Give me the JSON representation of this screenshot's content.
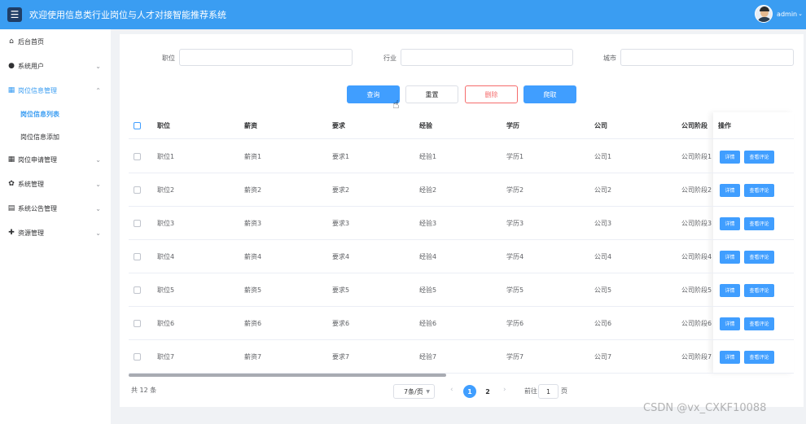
{
  "header": {
    "menu_icon": "☰",
    "title": "欢迎使用信息类行业岗位与人才对接智能推荐系统",
    "user_name": "admin",
    "user_caret": "⌄"
  },
  "sidebar": {
    "items": [
      {
        "label": "后台首页",
        "icon": "⌂"
      },
      {
        "label": "系统用户",
        "icon": "●",
        "chevron": "⌄"
      },
      {
        "label": "岗位信息管理",
        "icon": "▦",
        "chevron": "⌃"
      },
      {
        "label": "岗位申请管理",
        "icon": "▦",
        "chevron": "⌄"
      },
      {
        "label": "系统管理",
        "icon": "✿",
        "chevron": "⌄"
      },
      {
        "label": "系统公告管理",
        "icon": "▤",
        "chevron": "⌄"
      },
      {
        "label": "资源管理",
        "icon": "✚",
        "chevron": "⌄"
      }
    ],
    "sub_items": [
      {
        "label": "岗位信息列表"
      },
      {
        "label": "岗位信息添加"
      }
    ]
  },
  "filters": {
    "position_label": "职位",
    "position_value": "",
    "industry_label": "行业",
    "industry_value": "",
    "city_label": "城市",
    "city_value": ""
  },
  "actions": {
    "search": "查询",
    "reset": "重置",
    "delete": "删除",
    "crawl": "爬取"
  },
  "table": {
    "columns": [
      "职位",
      "薪资",
      "要求",
      "经验",
      "学历",
      "公司",
      "公司阶段",
      "操作"
    ],
    "rows": [
      [
        "职位1",
        "薪资1",
        "要求1",
        "经验1",
        "学历1",
        "公司1",
        "公司阶段1"
      ],
      [
        "职位2",
        "薪资2",
        "要求2",
        "经验2",
        "学历2",
        "公司2",
        "公司阶段2"
      ],
      [
        "职位3",
        "薪资3",
        "要求3",
        "经验3",
        "学历3",
        "公司3",
        "公司阶段3"
      ],
      [
        "职位4",
        "薪资4",
        "要求4",
        "经验4",
        "学历4",
        "公司4",
        "公司阶段4"
      ],
      [
        "职位5",
        "薪资5",
        "要求5",
        "经验5",
        "学历5",
        "公司5",
        "公司阶段5"
      ],
      [
        "职位6",
        "薪资6",
        "要求6",
        "经验6",
        "学历6",
        "公司6",
        "公司阶段6"
      ],
      [
        "职位7",
        "薪资7",
        "要求7",
        "经验7",
        "学历7",
        "公司7",
        "公司阶段7"
      ]
    ],
    "row_actions": {
      "detail": "详情",
      "review": "查看评论"
    }
  },
  "pagination": {
    "total": "共 12 条",
    "page_size": "7条/页",
    "prev": "‹",
    "pages": [
      "1",
      "2"
    ],
    "next": "›",
    "goto_label": "前往",
    "goto_value": "1",
    "goto_suffix": "页"
  },
  "watermark": "CSDN @vx_CXKF10088",
  "colors": {
    "header": "#3a9df2",
    "primary": "#409eff",
    "danger": "#f56c6c"
  }
}
